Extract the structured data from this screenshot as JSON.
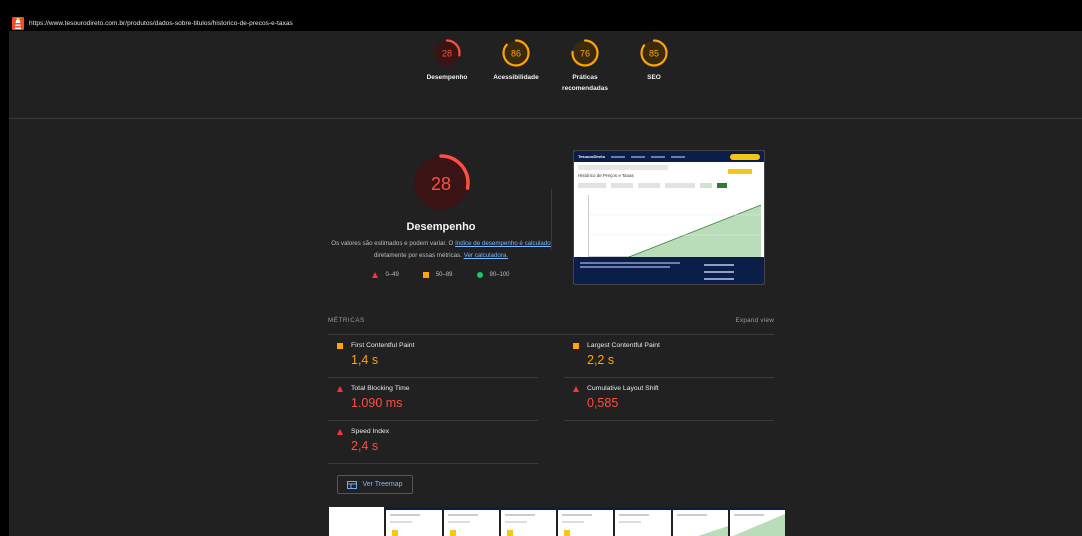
{
  "browser": {
    "url": "https://www.tesourodireto.com.br/produtos/dados-sobre-titulos/historico-de-precos-e-taxas"
  },
  "colors": {
    "fail": "#ff4e42",
    "average": "#ffa400",
    "pass": "#0cce6b",
    "link": "#7ab8ff",
    "background": "#212121"
  },
  "scores": [
    {
      "id": "performance",
      "value": "28",
      "fraction": 0.28,
      "label": "Desempenho",
      "color": "#ff4e42"
    },
    {
      "id": "accessibility",
      "value": "86",
      "fraction": 0.86,
      "label": "Acessibilidade",
      "color": "#ffa400"
    },
    {
      "id": "best-practices",
      "value": "76",
      "fraction": 0.76,
      "label": "Práticas recomendadas",
      "color": "#ffa400"
    },
    {
      "id": "seo",
      "value": "85",
      "fraction": 0.85,
      "label": "SEO",
      "color": "#ffa400"
    }
  ],
  "performance": {
    "score": "28",
    "fraction": 0.28,
    "title": "Desempenho",
    "desc_prefix": "Os valores são estimados e podem variar. O ",
    "desc_link1": "índice de desempenho é calculado",
    "desc_mid": " diretamente por essas métricas. ",
    "desc_link2": "Ver calculadora.",
    "legend": {
      "fail": "0–49",
      "average": "50–89",
      "pass": "90–100"
    }
  },
  "screenshot": {
    "site_brand": "TesouroDireto",
    "page_heading": "Histórico de Preços e Taxas"
  },
  "metrics": {
    "heading": "MÉTRICAS",
    "expand": "Expand view",
    "items": [
      {
        "name": "First Contentful Paint",
        "value": "1,4 s",
        "rating": "average"
      },
      {
        "name": "Largest Contentful Paint",
        "value": "2,2 s",
        "rating": "average"
      },
      {
        "name": "Total Blocking Time",
        "value": "1.090 ms",
        "rating": "fail"
      },
      {
        "name": "Cumulative Layout Shift",
        "value": "0,585",
        "rating": "fail"
      },
      {
        "name": "Speed Index",
        "value": "2,4 s",
        "rating": "fail"
      }
    ]
  },
  "treemap": {
    "label": "Ver Treemap"
  }
}
